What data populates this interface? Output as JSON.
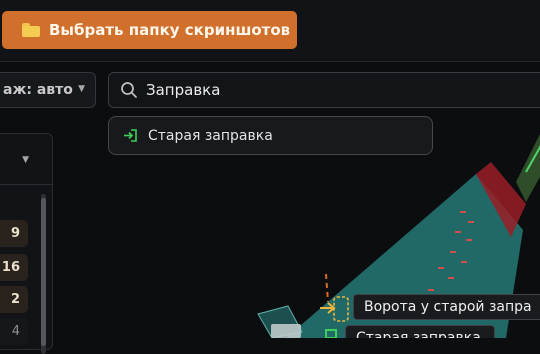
{
  "toolbar": {
    "pick_folder_label": "Выбрать папку скриншотов",
    "folder_icon": "folder-icon",
    "accent_color": "#d0702c"
  },
  "floor": {
    "value": "аж: авто"
  },
  "search": {
    "value": "Заправка",
    "icon": "search-icon"
  },
  "suggestions": [
    {
      "label": "Старая заправка",
      "icon": "entry-icon",
      "icon_color": "#3ecf5a"
    }
  ],
  "side_counts": [
    "9",
    "16",
    "2",
    "4"
  ],
  "map": {
    "labels": [
      {
        "text": "Ворота у старой запра"
      },
      {
        "text": "Старая заправка"
      }
    ]
  }
}
